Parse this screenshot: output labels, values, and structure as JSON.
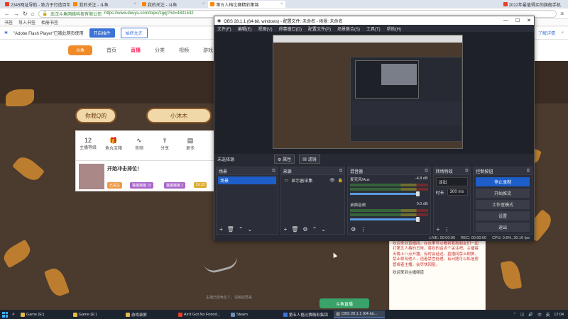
{
  "browser": {
    "tabs": [
      {
        "title": "2345网址导航 - 致力于打造百年品牌"
      },
      {
        "title": "我的关注 - 斗鱼"
      },
      {
        "title": "我的关注 - 斗鱼"
      },
      {
        "title": "第五人格比赛精彩集锦",
        "active": true
      },
      {
        "title": "2022年最值得买的旗舰手机"
      }
    ],
    "site_name": "武汉斗鱼网络科技有限公司",
    "url": "https://www.douyu.com/topic/zgqj?rid=4801532",
    "bookmarks": [
      "书签",
      "导入书签",
      "相册书签"
    ],
    "flash_notice": "\"Adobe Flash Player\"已被此网页使用",
    "flash_enable": "开启插件",
    "flash_always": "始终允许",
    "flash_learn": "了解详情"
  },
  "site": {
    "nav": [
      "首页",
      "直播",
      "分类",
      "视频",
      "游戏"
    ],
    "logo": "斗鱼",
    "pill_left": "你我Q的",
    "pill_right": "小沐木",
    "stats": [
      {
        "num": "12",
        "label": "主播等级"
      },
      {
        "num": "",
        "label": "鱼丸宝箱"
      },
      {
        "num": "",
        "label": "音频"
      },
      {
        "num": "",
        "label": "分享"
      },
      {
        "num": "",
        "label": "更多"
      }
    ],
    "card_title": "开始冲击排位！",
    "card_tags": [
      "已关注",
      "猫猫猪猪 15",
      "猫猫猪猪 2",
      "LV.10"
    ],
    "right_note": "欢迎来到直播间，在这里可以看到我和朋友们一起打第五人格的日常，喜欢的话点个关注吧。主播每天晚上八点开播，有时会延迟。直播间禁止刷屏、禁止辱骂他人，违者禁言处理。有问题可以私信房管或者主播，会尽快回复。",
    "right_note_footer": "欢迎来到主播频道",
    "bottom_text": "主播已经休息了，请稍后再来",
    "enter_button": "斗鱼直播"
  },
  "obs": {
    "title": "OBS 28.1.1 (64-bit, windows) - 配置文件: 未命名 - 场景: 未命名",
    "menu": [
      "文件(F)",
      "编辑(E)",
      "视图(V)",
      "停靠窗口(D)",
      "配置文件(P)",
      "场景集合(S)",
      "工具(T)",
      "帮助(H)"
    ],
    "no_source": "未选择源",
    "properties": "属性",
    "filters": "滤镜",
    "docks": {
      "scenes": "场景",
      "sources": "来源",
      "mixer": "混音器",
      "transitions": "转场特效",
      "controls": "控制按钮"
    },
    "scene_items": [
      "场景"
    ],
    "source_items": [
      "显示器采集"
    ],
    "mixer_tracks": [
      {
        "name": "麦克风/Aux",
        "db": "-4.8 dB",
        "level": 0.85
      },
      {
        "name": "桌面音频",
        "db": "0.0 dB",
        "level": 0.9
      }
    ],
    "transition": {
      "type": "淡出",
      "duration_label": "时长",
      "duration": "300 ms"
    },
    "controls": [
      "停止录制",
      "开始推流",
      "工作室模式",
      "设置",
      "退出"
    ],
    "status": {
      "live": "LIVE: 00:00:00",
      "rec": "REC: 00:00:00",
      "cpu": "CPU: 0.6%, 30.16 fps"
    }
  },
  "taskbar": {
    "items": [
      {
        "label": "Game (E:)",
        "color": "#e8b84a"
      },
      {
        "label": "Game (E:)",
        "color": "#e8b84a"
      },
      {
        "label": "游戏录屏",
        "color": "#e8b84a"
      },
      {
        "label": "Ain't Got No Friend...",
        "color": "#e4402a"
      },
      {
        "label": "Steam",
        "color": "#1b2838"
      },
      {
        "label": "第五人格比赛精彩集锦",
        "color": "#3b73d6"
      },
      {
        "label": "OBS 28.1.1 (64-bit...",
        "color": "#444",
        "active": true
      }
    ],
    "ime": "中",
    "lang": "英",
    "time": "12:04"
  }
}
